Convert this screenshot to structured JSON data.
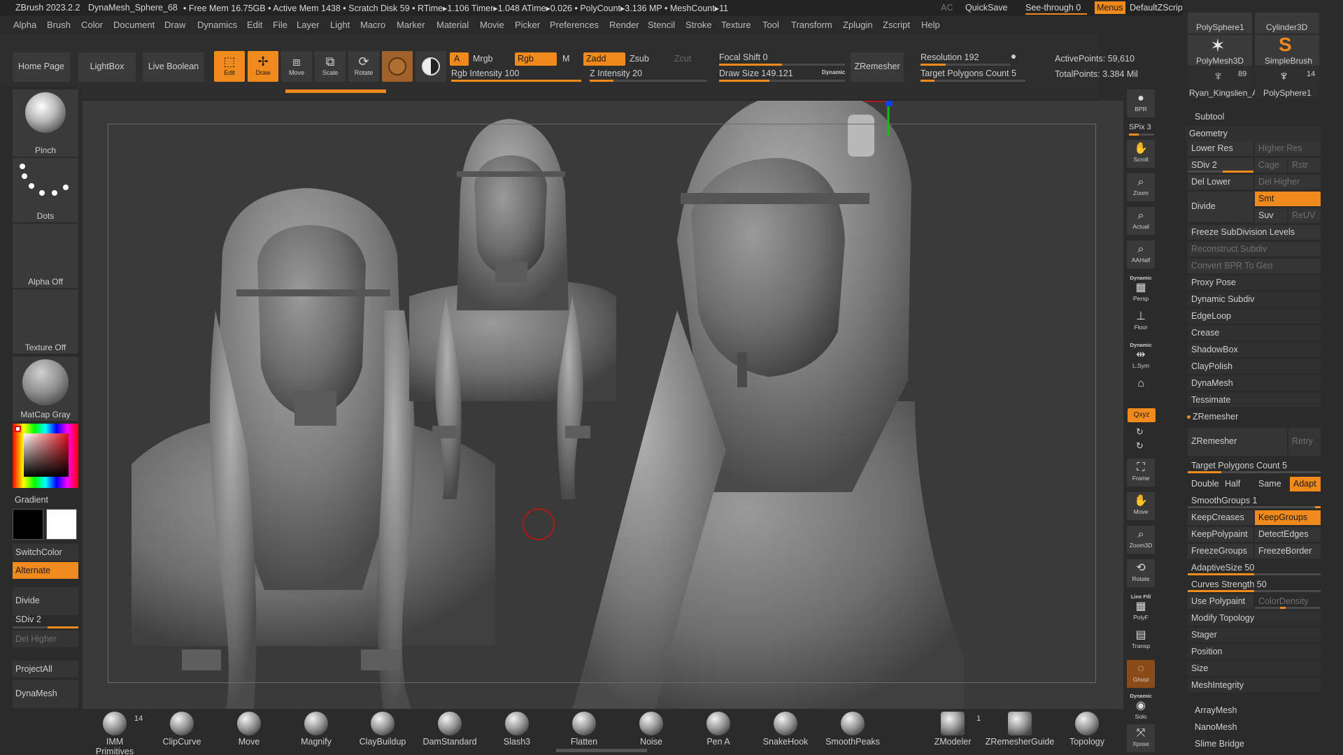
{
  "title": {
    "app": "ZBrush 2023.2.2",
    "doc": "DynaMesh_Sphere_68",
    "stats": "• Free Mem 16.75GB • Active Mem 1438 • Scratch Disk 59 • RTime▸1.106 Timer▸1.048 ATime▸0.026 • PolyCount▸3.136 MP • MeshCount▸11",
    "ac": "AC",
    "quicksave": "QuickSave",
    "seethrough": "See-through  0",
    "menus": "Menus",
    "script": "DefaultZScript"
  },
  "menus": [
    "Alpha",
    "Brush",
    "Color",
    "Document",
    "Draw",
    "Dynamics",
    "Edit",
    "File",
    "Layer",
    "Light",
    "Macro",
    "Marker",
    "Material",
    "Movie",
    "Picker",
    "Preferences",
    "Render",
    "Stencil",
    "Stroke",
    "Texture",
    "Tool",
    "Transform",
    "Zplugin",
    "Zscript",
    "Help"
  ],
  "toolbar": {
    "home": "Home Page",
    "lightbox": "LightBox",
    "liveboolean": "Live Boolean",
    "edit": "Edit",
    "draw": "Draw",
    "move": "Move",
    "scale": "Scale",
    "rotate": "Rotate",
    "a": "A",
    "mrgb": "Mrgb",
    "rgb": "Rgb",
    "m": "M",
    "zadd": "Zadd",
    "zsub": "Zsub",
    "zcut": "Zcut",
    "rgb_intensity": "Rgb Intensity 100",
    "z_intensity": "Z Intensity 20",
    "focal_shift": "Focal Shift 0",
    "draw_size": "Draw Size 149.121",
    "dynamic": "Dynamic",
    "zremesher": "ZRemesher",
    "resolution": "Resolution 192",
    "target_poly": "Target Polygons Count 5",
    "active_points": "ActivePoints: 59,610",
    "total_points": "TotalPoints: 3.384 Mil"
  },
  "left": {
    "brush": "Pinch",
    "stroke": "Dots",
    "alpha": "Alpha Off",
    "texture": "Texture Off",
    "material": "MatCap Gray",
    "gradient": "Gradient",
    "switchcolor": "SwitchColor",
    "alternate": "Alternate",
    "divide": "Divide",
    "sdiv": "SDiv 2",
    "delhigher": "Del Higher",
    "projectall": "ProjectAll",
    "dynamesh": "DynaMesh"
  },
  "strip": {
    "bpr": "BPR",
    "spix": "SPix 3",
    "scroll": "Scroll",
    "zoom": "Zoom",
    "actual": "Actual",
    "aahalf": "AAHalf",
    "persp_dyn": "Dynamic",
    "persp": "Persp",
    "floor": "Floor",
    "lsym_dyn": "Dynamic",
    "lsym": "L.Sym",
    "xyz": "Qxyz",
    "frame": "Frame",
    "move": "Move",
    "zoom3d": "Zoom3D",
    "rotate": "Rotate",
    "polyf_top": "Line Fill",
    "polyf": "PolyF",
    "transp": "Transp",
    "ghost": "Ghost",
    "solo_dyn": "Dynamic",
    "solo": "Solo",
    "xpose": "Xpose"
  },
  "tools": {
    "t1": "PolySphere1",
    "t2": "Cylinder3D",
    "t3": "PolyMesh3D",
    "t4": "SimpleBrush",
    "t5": "Ryan_Kingslien_A",
    "t6": "PolySphere1",
    "n1": "89",
    "n2": "14"
  },
  "subtool": "Subtool",
  "geometry": {
    "title": "Geometry",
    "lowerres": "Lower Res",
    "higherres": "Higher Res",
    "sdiv": "SDiv 2",
    "cage": "Cage",
    "rstr": "Rstr",
    "dellower": "Del Lower",
    "delhigher": "Del Higher",
    "divide": "Divide",
    "smt": "Smt",
    "suv": "Suv",
    "reuv": "ReUV",
    "freeze": "Freeze SubDivision Levels",
    "reconstruct": "Reconstruct Subdiv",
    "convertbpr": "Convert BPR To Geo",
    "proxypose": "Proxy Pose",
    "dynsubdiv": "Dynamic Subdiv",
    "edgeloop": "EdgeLoop",
    "crease": "Crease",
    "shadowbox": "ShadowBox",
    "claypolish": "ClayPolish",
    "dynamesh": "DynaMesh",
    "tessimate": "Tessimate",
    "zremesher": "ZRemesher",
    "zremesher_btn": "ZRemesher",
    "retry": "Retry",
    "target": "Target Polygons Count 5",
    "double": "Double",
    "half": "Half",
    "same": "Same",
    "adapt": "Adapt",
    "smoothgroups": "SmoothGroups 1",
    "keepcreases": "KeepCreases",
    "keepgroups": "KeepGroups",
    "keeppolypaint": "KeepPolypaint",
    "detectedges": "DetectEdges",
    "freezegroups": "FreezeGroups",
    "freezeborder": "FreezeBorder",
    "adaptivesize": "AdaptiveSize 50",
    "curves": "Curves Strength 50",
    "usepolypaint": "Use Polypaint",
    "colordensity": "ColorDensity",
    "modifytopo": "Modify Topology",
    "stager": "Stager",
    "position": "Position",
    "size": "Size",
    "meshintegrity": "MeshIntegrity"
  },
  "after": {
    "arraymesh": "ArrayMesh",
    "nanomesh": "NanoMesh",
    "slimebridge": "Slime Bridge"
  },
  "shelf": {
    "imm": "IMM Primitives",
    "imm_n": "14",
    "clipcurve": "ClipCurve",
    "move": "Move",
    "magnify": "Magnify",
    "claybuildup": "ClayBuildup",
    "damstandard": "DamStandard",
    "slash3": "Slash3",
    "flatten": "Flatten",
    "noise": "Noise",
    "pena": "Pen A",
    "snakehook": "SnakeHook",
    "smoothpeaks": "SmoothPeaks",
    "zmodeler": "ZModeler",
    "zmodeler_n": "1",
    "zremesherguide": "ZRemesherGuide",
    "topology": "Topology"
  },
  "colors": {
    "accent": "#f08a1c",
    "panel": "#2b2b2b",
    "viewport": "#3a3a3a"
  }
}
